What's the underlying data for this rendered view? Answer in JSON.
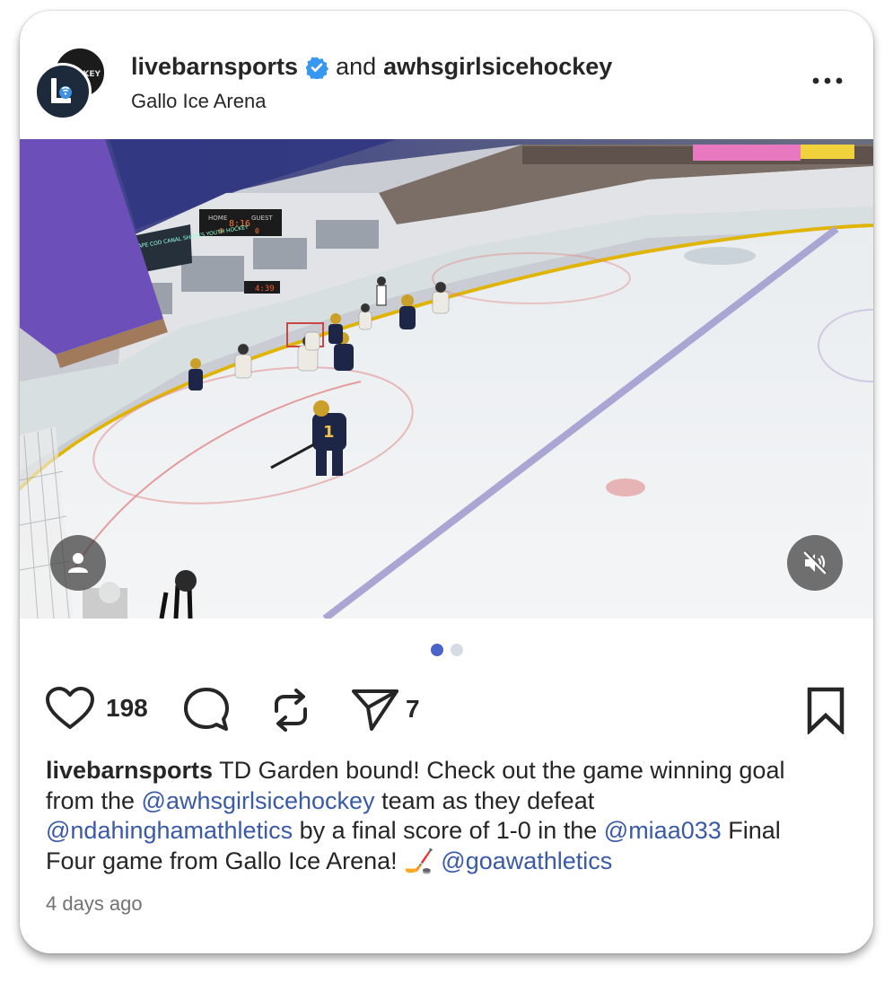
{
  "post": {
    "author": "livebarnsports",
    "and_text": "and",
    "coauthor": "awhsgirlsicehockey",
    "location": "Gallo Ice Arena",
    "avatar_back_text": "KEY",
    "more_label": "..."
  },
  "media": {
    "scoreboard_home_label": "HOME",
    "scoreboard_guest_label": "GUEST",
    "scoreboard_time": "8:16",
    "scoreboard_home": "0",
    "scoreboard_guest": "0",
    "clock_small": "4:39",
    "banner_text": "CAPE COD CANAL SHARKS YOUTH HOCKEY",
    "player_number": "1",
    "carousel_count": 2,
    "carousel_active": 0
  },
  "actions": {
    "likes": "198",
    "shares": "7"
  },
  "caption": {
    "username": "livebarnsports",
    "text1": " TD Garden bound! Check out the game winning goal from the ",
    "mention1": "@awhsgirlsicehockey",
    "text2": " team as they defeat ",
    "mention2": "@ndahinghamathletics",
    "text3": " by a final score of 1-0 in the ",
    "mention3": "@miaa033",
    "text4": " Final Four game from Gallo Ice Arena! 🏒  ",
    "mention4": "@goawathletics"
  },
  "timestamp": "4 days ago",
  "colors": {
    "accent": "#4a6fd6",
    "mention": "#3a5aa8",
    "verified": "#3897f0",
    "dot_active": "#4a63c9",
    "dot_inactive": "#d6dbe6"
  }
}
